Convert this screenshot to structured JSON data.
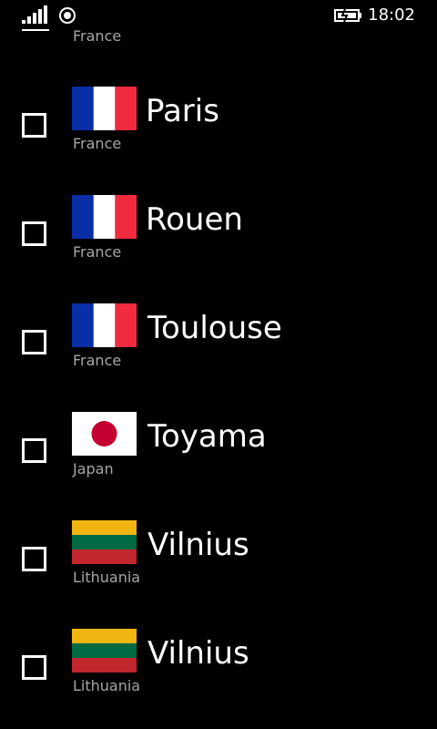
{
  "status_bar": {
    "time": "18:02",
    "signal_icon": "signal-strength-icon",
    "location_icon": "location-icon",
    "battery_icon": "battery-charging-icon"
  },
  "list": {
    "partial_top_country": "France",
    "items": [
      {
        "city": "Paris",
        "country": "France",
        "flag": "france-flag-icon",
        "checked": false
      },
      {
        "city": "Rouen",
        "country": "France",
        "flag": "france-flag-icon",
        "checked": false
      },
      {
        "city": "Toulouse",
        "country": "France",
        "flag": "france-flag-icon",
        "checked": false
      },
      {
        "city": "Toyama",
        "country": "Japan",
        "flag": "japan-flag-icon",
        "checked": false
      },
      {
        "city": "Vilnius",
        "country": "Lithuania",
        "flag": "lithuania-flag-icon",
        "checked": false
      },
      {
        "city": "Vilnius",
        "country": "Lithuania",
        "flag": "lithuania-flag-icon",
        "checked": false
      }
    ]
  },
  "colors": {
    "background": "#000000",
    "text_primary": "#ffffff",
    "text_secondary": "#a6a6a6",
    "france_blue": "#0a2ea6",
    "france_red": "#ef2b3d",
    "japan_red": "#c3002f",
    "lithuania_yellow": "#f1b512",
    "lithuania_green": "#006a44",
    "lithuania_red": "#c1272d"
  }
}
